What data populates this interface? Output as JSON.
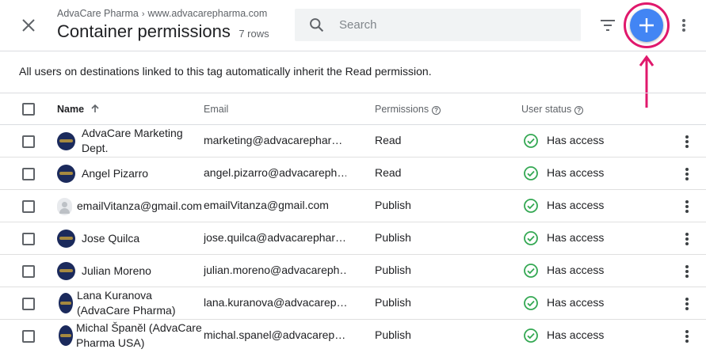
{
  "header": {
    "breadcrumb_account": "AdvaCare Pharma",
    "breadcrumb_container": "www.advacarepharma.com",
    "title": "Container permissions",
    "row_count": "7 rows",
    "search_placeholder": "Search"
  },
  "icons": {
    "close": "close-icon",
    "search": "search-icon",
    "filter": "filter-icon",
    "add": "add-icon",
    "more": "more-vert-icon",
    "status": "check-circle-icon",
    "help": "help-icon",
    "sort": "arrow-up-icon"
  },
  "colors": {
    "accent": "#4285f4",
    "highlight": "#e0186c",
    "status_ok": "#34a853"
  },
  "banner": "All users on destinations linked to this tag automatically inherit the Read permission.",
  "columns": {
    "name": "Name",
    "email": "Email",
    "permissions": "Permissions",
    "user_status": "User status"
  },
  "rows": [
    {
      "name_line1": "AdvaCare Marketing",
      "name_line2": "Dept.",
      "email": "marketing@advacarephar…",
      "permission": "Read",
      "status": "Has access"
    },
    {
      "name_line1": "Angel Pizarro",
      "name_line2": "",
      "email": "angel.pizarro@advacareph…",
      "permission": "Read",
      "status": "Has access"
    },
    {
      "name_line1": "emailVitanza@gmail.com",
      "name_line2": "",
      "email": "emailVitanza@gmail.com",
      "permission": "Publish",
      "status": "Has access"
    },
    {
      "name_line1": "Jose Quilca",
      "name_line2": "",
      "email": "jose.quilca@advacarephar…",
      "permission": "Publish",
      "status": "Has access"
    },
    {
      "name_line1": "Julian Moreno",
      "name_line2": "",
      "email": "julian.moreno@advacareph…",
      "permission": "Publish",
      "status": "Has access"
    },
    {
      "name_line1": "Lana Kuranova",
      "name_line2": "(AdvaCare Pharma)",
      "email": "lana.kuranova@advacarep…",
      "permission": "Publish",
      "status": "Has access"
    },
    {
      "name_line1": "Michal Španěl (AdvaCare",
      "name_line2": "Pharma USA)",
      "email": "michal.spanel@advacarep…",
      "permission": "Publish",
      "status": "Has access"
    }
  ]
}
